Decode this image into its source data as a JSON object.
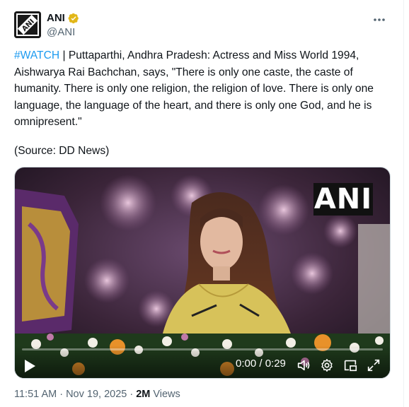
{
  "author": {
    "name": "ANI",
    "handle": "@ANI",
    "avatar_text": "ANI"
  },
  "tweet": {
    "hashtag": "#WATCH",
    "body": " | Puttaparthi, Andhra Pradesh: Actress and Miss World 1994, Aishwarya Rai Bachchan, says, \"There is only one caste, the caste of humanity. There is only one religion, the religion of love. There is only one language, the language of the heart, and there is only one God, and he is omnipresent.\"",
    "source": "(Source: DD News)"
  },
  "video": {
    "watermark": "ANI",
    "time": "0:00 / 0:29",
    "progress": 0
  },
  "meta": {
    "timestamp": "11:51 AM · Nov 19, 2025 ·",
    "views_count": "2M",
    "views_label": "Views"
  },
  "colors": {
    "accent": "#1d9bf0",
    "verified": "#e2b719",
    "muted_text": "#536471"
  },
  "icons": [
    "verified-badge-icon",
    "more-icon",
    "play-icon",
    "volume-icon",
    "settings-icon",
    "pip-icon",
    "fullscreen-icon"
  ]
}
